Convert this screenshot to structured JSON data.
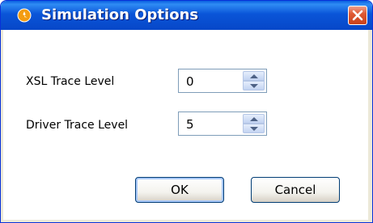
{
  "window": {
    "title": "Simulation Options",
    "app_icon": "orange-circle-icon",
    "close_icon": "close-icon"
  },
  "fields": [
    {
      "label": "XSL Trace Level",
      "value": "0"
    },
    {
      "label": "Driver Trace Level",
      "value": "5"
    }
  ],
  "buttons": {
    "ok_label": "OK",
    "cancel_label": "Cancel"
  },
  "colors": {
    "titlebar": "#0a55d8",
    "close_button": "#e05a34",
    "app_icon": "#f39c12"
  }
}
